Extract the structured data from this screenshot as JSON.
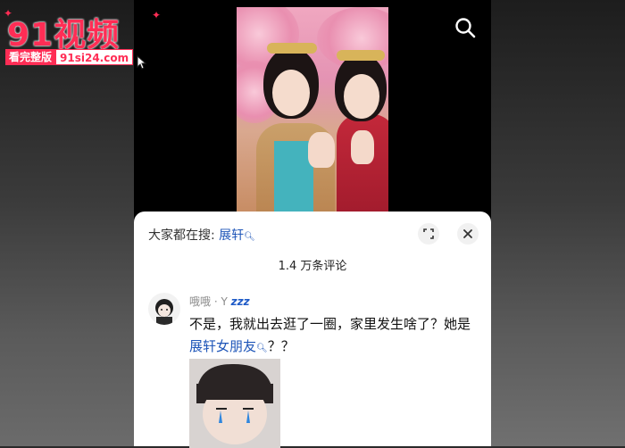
{
  "watermark": {
    "title": "91视频",
    "sub_left": "看完整版",
    "sub_right": "91si24.com"
  },
  "video": {
    "search_icon": "search-icon"
  },
  "comments": {
    "hot_search_label": "大家都在搜:",
    "hot_search_keyword": "展轩",
    "count_label": "1.4 万条评论",
    "expand_icon": "expand-icon",
    "close_icon": "close-icon",
    "items": [
      {
        "username": "哦哦 · Y",
        "status_badge": "zzz",
        "text_line1": "不是，我就出去逛了一圈，家里发生啥了？她是",
        "text_line2_keyword": "展轩女朋友",
        "text_line2_rest": "？？"
      }
    ]
  }
}
